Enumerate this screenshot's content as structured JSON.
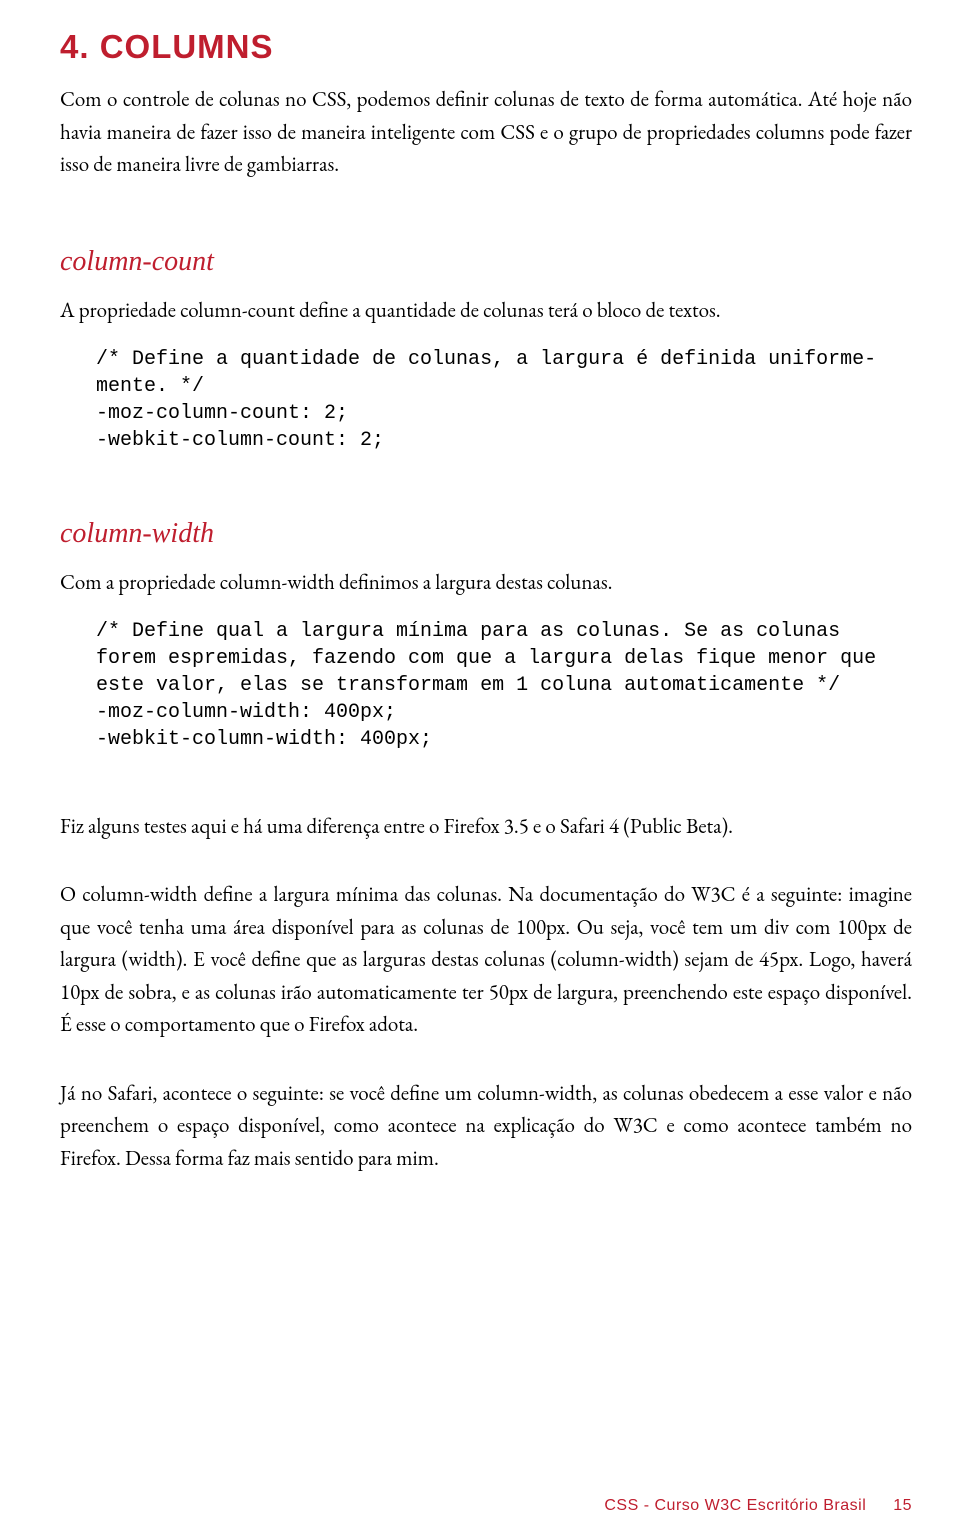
{
  "chapter_title": "4. COLUMNS",
  "intro_p1": "Com o controle de colunas no CSS, podemos definir colunas de texto de forma automática. Até hoje não havia maneira de fazer isso de maneira inteligente com CSS e o grupo de propriedades columns pode fazer isso de maneira livre de gambiarras.",
  "s1_heading": "column-count",
  "s1_desc": "A propriedade column-count define a quantidade de colunas terá o bloco de textos.",
  "s1_code": "/* Define a quantidade de colunas, a largura é definida uniforme-\nmente. */\n-moz-column-count: 2;\n-webkit-column-count: 2;",
  "s2_heading": "column-width",
  "s2_desc": "Com a propriedade column-width definimos a largura destas colunas.",
  "s2_code": "/* Define qual a largura mínima para as colunas. Se as colunas forem espremidas, fazendo com que a largura delas fique menor que este valor, elas se transformam em 1 coluna automaticamente */\n-moz-column-width: 400px;\n-webkit-column-width: 400px;",
  "tail_p1": "Fiz alguns testes aqui e há uma diferença entre o Firefox 3.5 e o Safari 4 (Public Beta).",
  "tail_p2": "O column-width define a largura mínima das colunas. Na documentação do W3C é a seguinte: imagine que você tenha uma área disponível para as colunas de 100px. Ou seja, você tem um div com 100px de largura (width). E você define que as larguras destas colunas (column-width) sejam de 45px. Logo, haverá 10px de sobra, e as colunas irão automaticamente ter 50px de largura, preenchendo este espaço disponível. É esse o comportamento que o Firefox adota.",
  "tail_p3": "Já no Safari, acontece o seguinte: se você define um column-width, as colunas obedecem a esse valor e não preenchem o espaço disponível, como acontece na explicação do W3C e como acontece também no Firefox. Dessa forma faz mais sentido para mim.",
  "footer_text": "CSS - Curso W3C Escritório Brasil",
  "page_number": "15"
}
